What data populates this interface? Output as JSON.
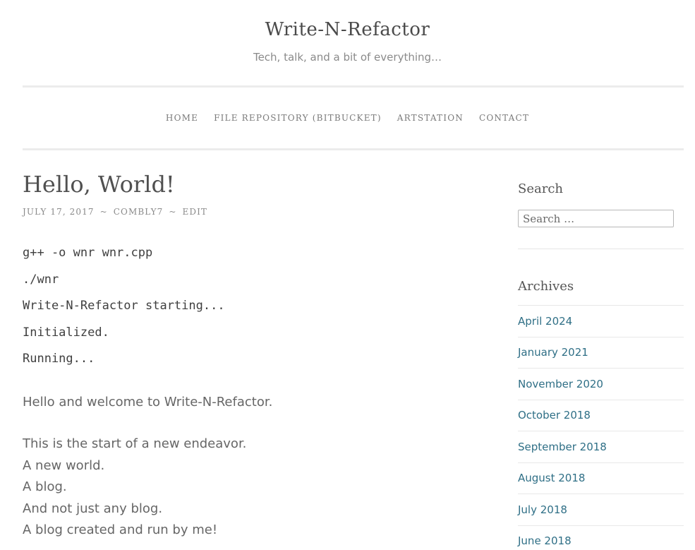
{
  "header": {
    "site_title": "Write-N-Refactor",
    "tagline": "Tech, talk, and a bit of everything…"
  },
  "nav": {
    "items": [
      {
        "label": "HOME"
      },
      {
        "label": "FILE REPOSITORY (BITBUCKET)"
      },
      {
        "label": "ARTSTATION"
      },
      {
        "label": "CONTACT"
      }
    ]
  },
  "post": {
    "title": "Hello, World!",
    "meta": {
      "date": "JULY 17, 2017",
      "separator": "~",
      "author": "COMBLY7",
      "edit": "EDIT"
    },
    "code_lines": [
      "g++ -o wnr wnr.cpp",
      "./wnr",
      "Write-N-Refactor starting...",
      "Initialized.",
      "Running..."
    ],
    "intro": "Hello and welcome to Write-N-Refactor.",
    "lines": [
      "This is the start of a new endeavor.",
      "A new world.",
      "A blog.",
      "And not just any blog.",
      "A blog created and run by me!"
    ]
  },
  "sidebar": {
    "search": {
      "title": "Search",
      "placeholder": "Search …"
    },
    "archives": {
      "title": "Archives",
      "items": [
        {
          "label": "April 2024"
        },
        {
          "label": "January 2021"
        },
        {
          "label": "November 2020"
        },
        {
          "label": "October 2018"
        },
        {
          "label": "September 2018"
        },
        {
          "label": "August 2018"
        },
        {
          "label": "July 2018"
        },
        {
          "label": "June 2018"
        }
      ]
    }
  },
  "colors": {
    "link": "#2f6f86",
    "text": "#666666",
    "heading": "#505050",
    "rule": "#ececec"
  }
}
